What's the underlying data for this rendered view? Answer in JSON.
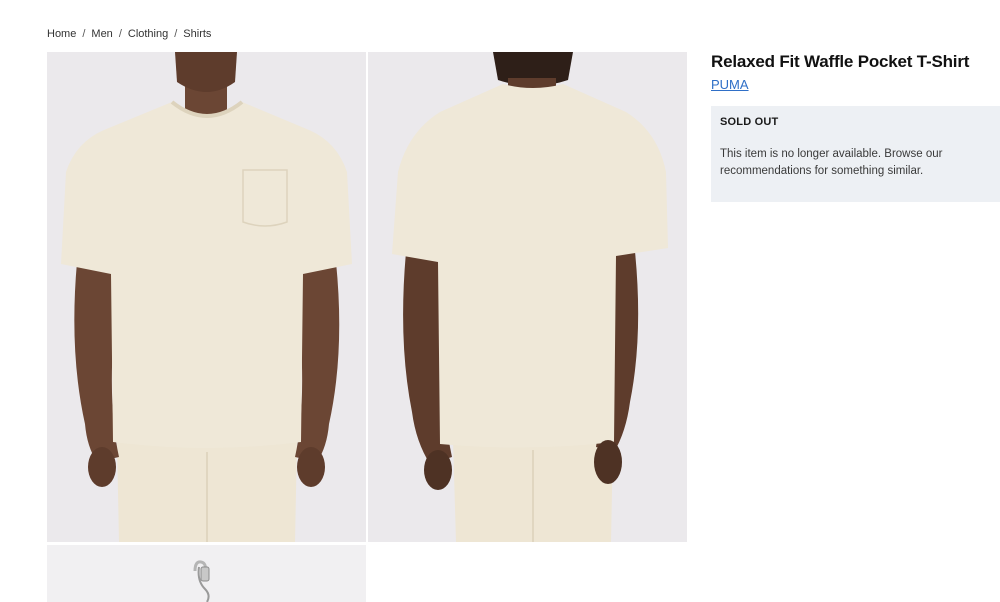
{
  "breadcrumb": {
    "items": [
      {
        "label": "Home"
      },
      {
        "label": "Men"
      },
      {
        "label": "Clothing"
      },
      {
        "label": "Shirts"
      }
    ],
    "separator": "/"
  },
  "gallery": {
    "images": [
      {
        "view": "front",
        "icon": "product-photo"
      },
      {
        "view": "back",
        "icon": "product-photo"
      },
      {
        "view": "detail-hanger",
        "icon": "hanger-photo"
      }
    ]
  },
  "product": {
    "title": "Relaxed Fit Waffle Pocket T-Shirt",
    "brand": "PUMA",
    "status": {
      "heading": "SOLD OUT",
      "message": "This item is no longer available. Browse our recommendations for something similar."
    }
  },
  "colors": {
    "link": "#2f6fc7",
    "soldout_bg": "#edf0f4",
    "shirt": "#efe8d8",
    "photo_bg": "#ebe9ec"
  }
}
